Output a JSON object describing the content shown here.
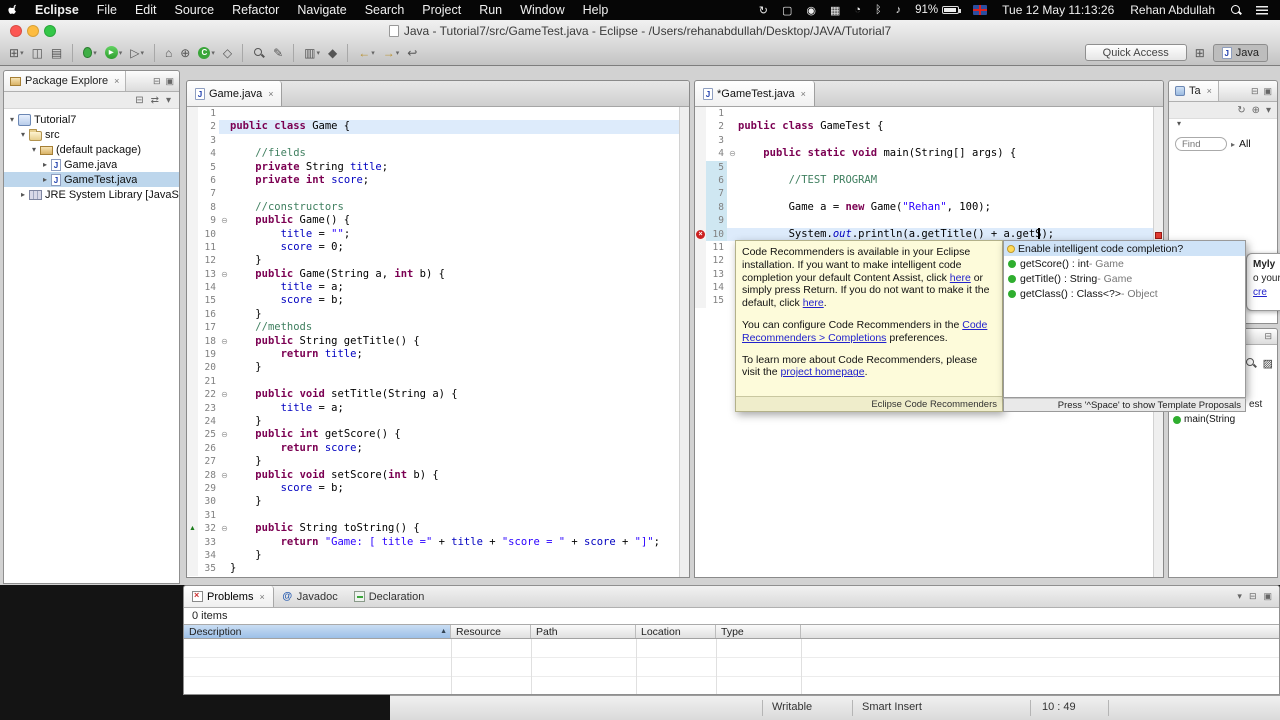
{
  "menubar": {
    "items": [
      "Eclipse",
      "File",
      "Edit",
      "Source",
      "Refactor",
      "Navigate",
      "Search",
      "Project",
      "Run",
      "Window",
      "Help"
    ],
    "status_icons": [
      "time-machine",
      "display",
      "record",
      "grid",
      "clock",
      "bluetooth",
      "volume"
    ],
    "battery": "91%",
    "clock": "Tue 12 May 11:13:26",
    "user": "Rehan Abdullah"
  },
  "titlebar": {
    "title": "Java - Tutorial7/src/GameTest.java - Eclipse - /Users/rehanabdullah/Desktop/JAVA/Tutorial7"
  },
  "toolbar": {
    "icons": [
      "new-wizard",
      "save",
      "print",
      "|",
      "debug",
      "run",
      "external-tools",
      "|",
      "new-java-project",
      "new-package",
      "new-class",
      "open-type",
      "|",
      "search",
      "annotate",
      "|",
      "coverage",
      "jar",
      "|",
      "back",
      "forward",
      "last-edit"
    ],
    "quick_access": "Quick Access",
    "perspective": "Java"
  },
  "package_explorer": {
    "tab": "Package Explore",
    "items": [
      {
        "label": "Tutorial7",
        "level": 0,
        "icon": "project",
        "arrow": "open"
      },
      {
        "label": "src",
        "level": 1,
        "icon": "src-folder",
        "ar1row": "open",
        "arrow": "open"
      },
      {
        "label": "(default package)",
        "level": 2,
        "icon": "package",
        "arrow": "open"
      },
      {
        "label": "Game.java",
        "level": 3,
        "icon": "java-file",
        "arrow": "closed"
      },
      {
        "label": "GameTest.java",
        "level": 3,
        "icon": "java-file",
        "arrow": "closed",
        "selected": true
      },
      {
        "label": "JRE System Library [JavaSE",
        "level": 1,
        "icon": "library",
        "arrow": "closed"
      }
    ]
  },
  "editor_left": {
    "tab": "Game.java",
    "current_line": 2,
    "fold_lines": [
      9,
      13,
      18,
      22,
      25,
      28,
      32
    ],
    "override_lines": [
      32
    ],
    "lines": [
      "",
      "public class Game {",
      "",
      "\t//fields",
      "\tprivate String title;",
      "\tprivate int score;",
      "",
      "\t//constructors",
      "\tpublic Game() {",
      "\t\ttitle = \"\";",
      "\t\tscore = 0;",
      "\t}",
      "\tpublic Game(String a, int b) {",
      "\t\ttitle = a;",
      "\t\tscore = b;",
      "\t}",
      "\t//methods",
      "\tpublic String getTitle() {",
      "\t\treturn title;",
      "\t}",
      "",
      "\tpublic void setTitle(String a) {",
      "\t\ttitle = a;",
      "\t}",
      "\tpublic int getScore() {",
      "\t\treturn score;",
      "\t}",
      "\tpublic void setScore(int b) {",
      "\t\tscore = b;",
      "\t}",
      "",
      "\tpublic String toString() {",
      "\t\treturn \"Game: [ title =\" + title + \"score = \" + score + \"]\";",
      "\t}",
      "}"
    ]
  },
  "editor_right": {
    "tab": "*GameTest.java",
    "current_line": 10,
    "fold_lines": [
      4
    ],
    "error_lines": [
      10
    ],
    "changed_lines": [
      5,
      6,
      7,
      8,
      9,
      10
    ],
    "lines": [
      "",
      "public class GameTest {",
      "",
      "\tpublic static void main(String[] args) {",
      "",
      "\t\t//TEST PROGRAM",
      "",
      "\t\tGame a = new Game(\"Rehan\", 100);",
      "",
      "\t\tSystem.out.println(a.getTitle() + a.getS);",
      "",
      "\t}",
      "}",
      "",
      ""
    ]
  },
  "recommenders_popup": {
    "paragraphs": [
      [
        {
          "t": "Code Recommenders is available in your Eclipse installation. If you want to make intelligent code completion your default Content Assist, click "
        },
        {
          "t": "here",
          "link": true
        },
        {
          "t": " or simply press Return. If you do not want to make it the default, click "
        },
        {
          "t": "here",
          "link": true
        },
        {
          "t": "."
        }
      ],
      [
        {
          "t": "You can configure Code Recommenders in the "
        },
        {
          "t": "Code Recommenders > Completions",
          "link": true
        },
        {
          "t": " preferences."
        }
      ],
      [
        {
          "t": "To learn more about Code Recommenders, please visit the "
        },
        {
          "t": "project homepage",
          "link": true
        },
        {
          "t": "."
        }
      ]
    ],
    "footer": "Eclipse Code Recommenders"
  },
  "completion": {
    "items": [
      {
        "label": "Enable intelligent code completion?",
        "icon": "bulb",
        "selected": true
      },
      {
        "label": "getScore() : int",
        "origin": "Game",
        "icon": "public-method"
      },
      {
        "label": "getTitle() : String",
        "origin": "Game",
        "icon": "public-method"
      },
      {
        "label": "getClass() : Class<?>",
        "origin": "Object",
        "icon": "public-method"
      }
    ],
    "hint": "Press '^Space' to show Template Proposals"
  },
  "right_panel": {
    "tab": "Ta",
    "find_placeholder": "Find",
    "filter": "All",
    "mylyn_fragments": [
      "Myly",
      "o your",
      "cre"
    ],
    "outline_item": "main(String",
    "text_fragment": "est"
  },
  "problems_panel": {
    "tabs": [
      {
        "label": "Problems",
        "active": true
      },
      {
        "label": "Javadoc",
        "active": false
      },
      {
        "label": "Declaration",
        "active": false
      }
    ],
    "items_count": "0 items",
    "columns": [
      "Description",
      "Resource",
      "Path",
      "Location",
      "Type"
    ]
  },
  "statusbar": {
    "writable": "Writable",
    "insert_mode": "Smart Insert",
    "caret_position": "10 : 49"
  }
}
